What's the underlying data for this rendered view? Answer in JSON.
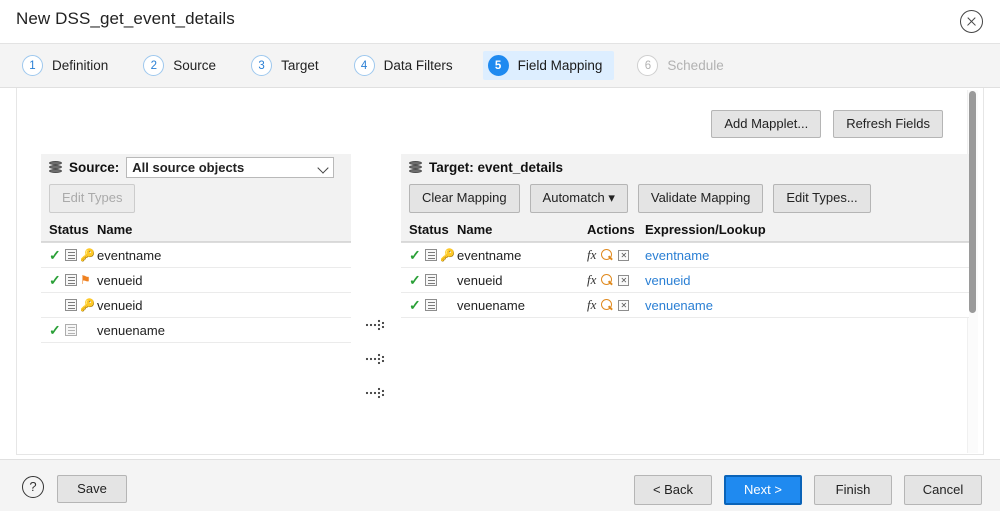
{
  "window": {
    "title": "New DSS_get_event_details",
    "close_icon": "close-icon"
  },
  "steps": [
    {
      "num": "1",
      "label": "Definition",
      "state": "done"
    },
    {
      "num": "2",
      "label": "Source",
      "state": "done"
    },
    {
      "num": "3",
      "label": "Target",
      "state": "done"
    },
    {
      "num": "4",
      "label": "Data Filters",
      "state": "done"
    },
    {
      "num": "5",
      "label": "Field Mapping",
      "state": "active"
    },
    {
      "num": "6",
      "label": "Schedule",
      "state": "disabled"
    }
  ],
  "toolbar": {
    "add_mapplet_label": "Add Mapplet...",
    "refresh_fields_label": "Refresh Fields"
  },
  "source": {
    "icon": "database-icon",
    "label": "Source:",
    "selected_object": "All source objects",
    "edit_types_label": "Edit Types",
    "columns": {
      "status": "Status",
      "name": "Name"
    },
    "rows": [
      {
        "checked": true,
        "doc": "normal",
        "marker": "key",
        "name": "eventname"
      },
      {
        "checked": true,
        "doc": "normal",
        "marker": "flag",
        "name": "venueid"
      },
      {
        "checked": false,
        "doc": "normal",
        "marker": "key",
        "name": "venueid"
      },
      {
        "checked": true,
        "doc": "grey",
        "marker": "none",
        "name": "venuename"
      }
    ]
  },
  "connectors": [
    {
      "icon": "mapping-arrow-icon"
    },
    {
      "icon": "mapping-arrow-icon"
    },
    {
      "icon": "mapping-arrow-icon"
    }
  ],
  "target": {
    "icon": "database-icon",
    "label": "Target: event_details",
    "buttons": {
      "clear_mapping": "Clear Mapping",
      "automatch": "Automatch",
      "automatch_caret": "▾",
      "validate_mapping": "Validate Mapping",
      "edit_types": "Edit Types..."
    },
    "columns": {
      "status": "Status",
      "name": "Name",
      "actions": "Actions",
      "expression": "Expression/Lookup"
    },
    "rows": [
      {
        "checked": true,
        "doc": "normal",
        "marker": "key",
        "name": "eventname",
        "fx": "fx",
        "expression": "eventname"
      },
      {
        "checked": true,
        "doc": "normal",
        "marker": "none",
        "name": "venueid",
        "fx": "fx",
        "expression": "venueid"
      },
      {
        "checked": true,
        "doc": "normal",
        "marker": "none",
        "name": "venuename",
        "fx": "fx",
        "expression": "venuename"
      }
    ]
  },
  "footer": {
    "help_icon": "?",
    "save_label": "Save",
    "back_label": "< Back",
    "next_label": "Next >",
    "finish_label": "Finish",
    "cancel_label": "Cancel"
  },
  "colors": {
    "accent": "#1f8af0",
    "active_step_bg": "#ddeeff",
    "check_green": "#2aa037",
    "key_yellow": "#e8b400",
    "flag_orange": "#ef8120",
    "link_blue": "#2a7fd4"
  }
}
